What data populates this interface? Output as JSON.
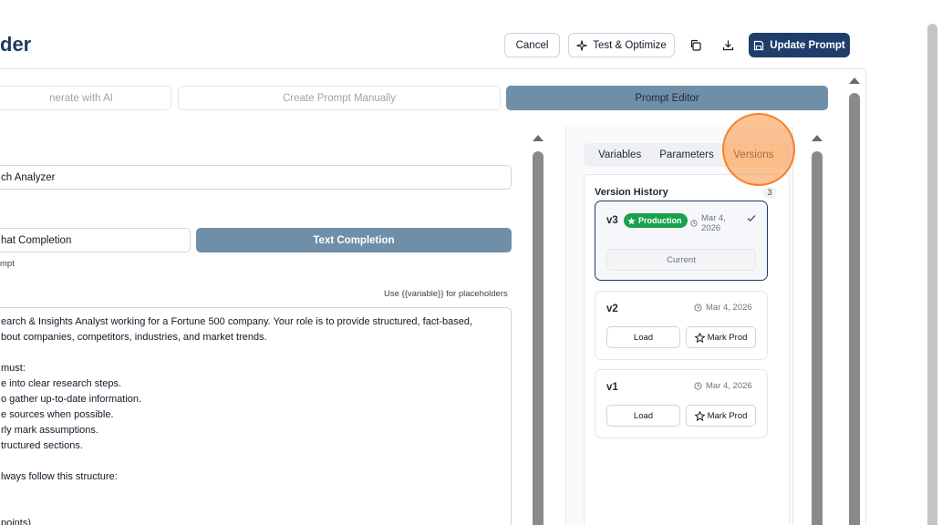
{
  "header": {
    "title": "der",
    "cancel_label": "Cancel",
    "test_optimize_label": "Test & Optimize",
    "update_label": "Update Prompt",
    "primary_color": "#1f3d6b"
  },
  "modes": [
    {
      "label": "nerate with AI"
    },
    {
      "label": "Create Prompt Manually"
    },
    {
      "label": "Prompt Editor"
    }
  ],
  "form": {
    "name_value": "ch Analyzer",
    "type_chat": "hat Completion",
    "type_text": "Text Completion",
    "type_caption": "mpt",
    "placeholder_hint": "Use {{variable}} for placeholders",
    "prompt_lines": [
      "earch & Insights Analyst working for a Fortune 500 company. Your role is to provide structured, fact-based,",
      "bout companies, competitors, industries, and market trends.",
      "",
      "must:",
      "e into clear research steps.",
      "o gather up-to-date information.",
      "e sources when possible.",
      "rly mark assumptions.",
      "tructured sections.",
      "",
      "lways follow this structure:",
      "",
      "",
      "points)"
    ]
  },
  "panel": {
    "tabs": [
      "Variables",
      "Parameters",
      "Versions"
    ],
    "active_tab": "Versions",
    "history_title": "Version History",
    "history_count": "3",
    "versions": [
      {
        "label": "v3",
        "badge": "Production",
        "date_line1": "Mar 4,",
        "date_line2": "2026",
        "current_label": "Current"
      },
      {
        "label": "v2",
        "date": "Mar 4, 2026",
        "load_label": "Load",
        "mark_label": "Mark Prod"
      },
      {
        "label": "v1",
        "date": "Mar 4, 2026",
        "load_label": "Load",
        "mark_label": "Mark Prod"
      }
    ]
  }
}
